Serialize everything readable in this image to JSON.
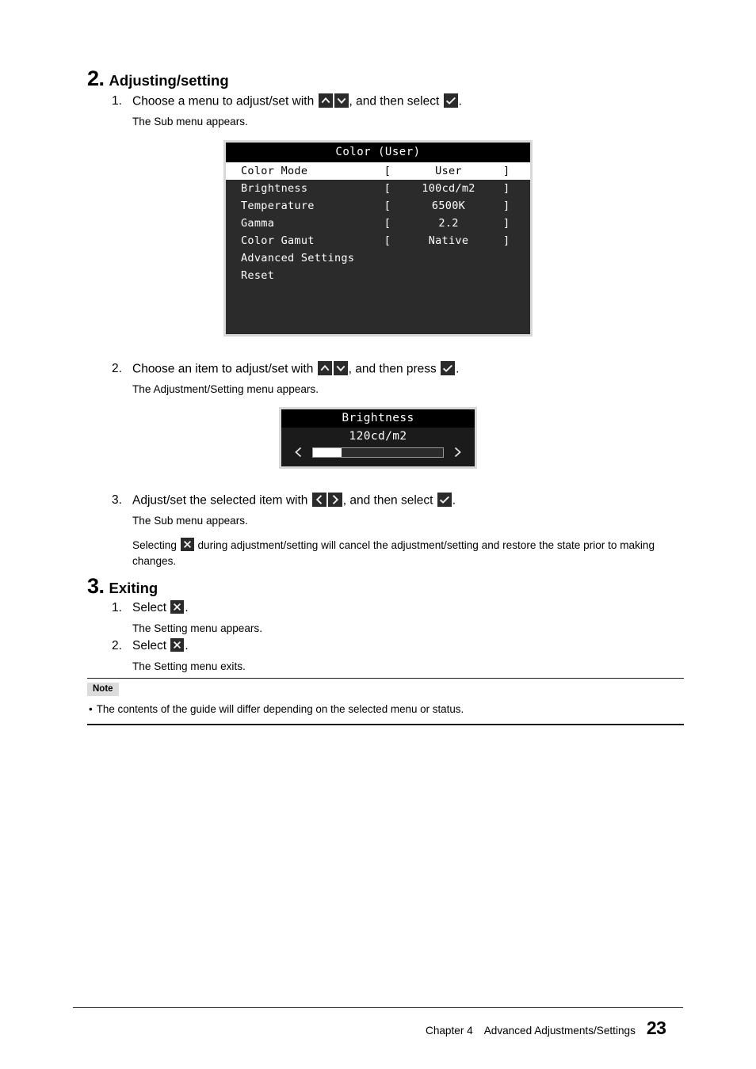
{
  "section_adjusting": {
    "number": "2",
    "title": "Adjusting/setting",
    "steps": [
      {
        "num": "1.",
        "text_before": "Choose a menu to adjust/set with",
        "text_middle": ", and then select",
        "text_after": ".",
        "icons_before": [
          "up-arrow",
          "down-arrow"
        ],
        "icon_after": "check",
        "result": "The Sub menu appears."
      },
      {
        "num": "2.",
        "text_before": "Choose an item to adjust/set with",
        "text_middle": ", and then press",
        "text_after": ".",
        "icons_before": [
          "up-arrow",
          "down-arrow"
        ],
        "icon_after": "check",
        "result": "The Adjustment/Setting menu appears."
      },
      {
        "num": "3.",
        "text_before": "Adjust/set the selected item with",
        "text_middle": ", and then select",
        "text_after": ".",
        "icons_before": [
          "left-arrow",
          "right-arrow"
        ],
        "icon_after": "check",
        "result": "The Sub menu appears.",
        "note_before": "Selecting",
        "note_icon": "close",
        "note_after": "during adjustment/setting will cancel the adjustment/setting and restore the state prior to making changes."
      }
    ]
  },
  "osd_menu": {
    "title": "Color (User)",
    "rows": [
      {
        "label": "Color Mode",
        "bracket_left": "[",
        "value": "User",
        "bracket_right": "]",
        "selected": true
      },
      {
        "label": "Brightness",
        "bracket_left": "[",
        "value": "100cd/m2",
        "bracket_right": "]",
        "selected": false
      },
      {
        "label": "Temperature",
        "bracket_left": "[",
        "value": "6500K",
        "bracket_right": "]",
        "selected": false
      },
      {
        "label": "Gamma",
        "bracket_left": "[",
        "value": "2.2",
        "bracket_right": "]",
        "selected": false
      },
      {
        "label": "Color Gamut",
        "bracket_left": "[",
        "value": "Native",
        "bracket_right": "]",
        "selected": false
      },
      {
        "label": "Advanced Settings",
        "bracket_left": "",
        "value": "",
        "bracket_right": "",
        "selected": false
      },
      {
        "label": "Reset",
        "bracket_left": "",
        "value": "",
        "bracket_right": "",
        "selected": false
      }
    ]
  },
  "osd_brightness": {
    "title": "Brightness",
    "value": "120cd/m2",
    "left_arrow": "<",
    "right_arrow": ">",
    "fill_percent": 22
  },
  "section_exiting": {
    "number": "3",
    "title": "Exiting",
    "steps": [
      {
        "num": "1.",
        "text_before": "Select",
        "icon": "close",
        "text_after": ".",
        "result": "The Setting menu appears."
      },
      {
        "num": "2.",
        "text_before": "Select",
        "icon": "close",
        "text_after": ".",
        "result": "The Setting menu exits."
      }
    ]
  },
  "note": {
    "label": "Note",
    "bullet": "•",
    "items": [
      "The contents of the guide will differ depending on the selected menu or status."
    ]
  },
  "footer": {
    "chapter": "Chapter 4",
    "chapter_title": "Advanced Adjustments/Settings",
    "page_number": "23"
  }
}
